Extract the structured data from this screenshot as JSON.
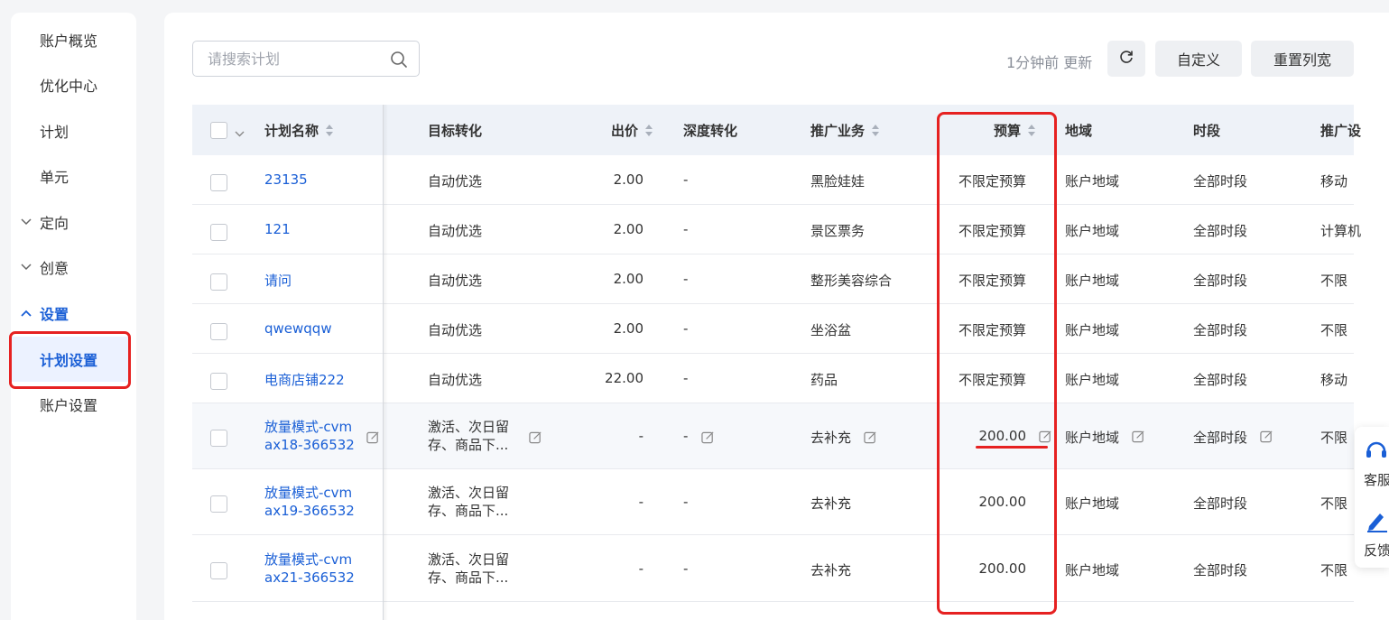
{
  "sidebar": {
    "items": [
      {
        "label": "账户概览"
      },
      {
        "label": "优化中心"
      },
      {
        "label": "计划"
      },
      {
        "label": "单元"
      },
      {
        "label": "定向"
      },
      {
        "label": "创意"
      },
      {
        "label": "设置"
      },
      {
        "label": "计划设置"
      },
      {
        "label": "账户设置"
      }
    ]
  },
  "toolbar": {
    "search_placeholder": "请搜索计划",
    "update_text": "1分钟前 更新",
    "custom_label": "自定义",
    "reset_label": "重置列宽"
  },
  "table": {
    "headers": {
      "name": "计划名称",
      "target": "目标转化",
      "bid": "出价",
      "deep": "深度转化",
      "business": "推广业务",
      "budget": "预算",
      "region": "地域",
      "period": "时段",
      "device": "推广设"
    },
    "rows": [
      {
        "name": "23135",
        "target": "自动优选",
        "bid": "2.00",
        "deep": "-",
        "business": "黑脸娃娃",
        "budget": "不限定预算",
        "region": "账户地域",
        "period": "全部时段",
        "device": "移动"
      },
      {
        "name": "121",
        "target": "自动优选",
        "bid": "2.00",
        "deep": "-",
        "business": "景区票务",
        "budget": "不限定预算",
        "region": "账户地域",
        "period": "全部时段",
        "device": "计算机"
      },
      {
        "name": "请问",
        "target": "自动优选",
        "bid": "2.00",
        "deep": "-",
        "business": "整形美容综合",
        "budget": "不限定预算",
        "region": "账户地域",
        "period": "全部时段",
        "device": "不限"
      },
      {
        "name": "qwewqqw",
        "target": "自动优选",
        "bid": "2.00",
        "deep": "-",
        "business": "坐浴盆",
        "budget": "不限定预算",
        "region": "账户地域",
        "period": "全部时段",
        "device": "不限"
      },
      {
        "name": "电商店铺222",
        "target": "自动优选",
        "bid": "22.00",
        "deep": "-",
        "business": "药品",
        "budget": "不限定预算",
        "region": "账户地域",
        "period": "全部时段",
        "device": "移动"
      },
      {
        "name_line1": "放量模式-cvm",
        "name_line2": "ax18-366532",
        "target_line1": "激活、次日留",
        "target_line2": "存、商品下...",
        "bid": "-",
        "deep": "-",
        "business": "去补充",
        "budget": "200.00",
        "region": "账户地域",
        "period": "全部时段",
        "device": "不限"
      },
      {
        "name_line1": "放量模式-cvm",
        "name_line2": "ax19-366532",
        "target_line1": "激活、次日留",
        "target_line2": "存、商品下...",
        "bid": "-",
        "deep": "-",
        "business": "去补充",
        "budget": "200.00",
        "region": "账户地域",
        "period": "全部时段",
        "device": "不限"
      },
      {
        "name_line1": "放量模式-cvm",
        "name_line2": "ax21-366532",
        "target_line1": "激活、次日留",
        "target_line2": "存、商品下...",
        "bid": "-",
        "deep": "-",
        "business": "去补充",
        "budget": "200.00",
        "region": "账户地域",
        "period": "全部时段",
        "device": "不限"
      }
    ]
  },
  "float": {
    "service_label": "客服",
    "feedback_label": "反馈"
  },
  "colors": {
    "accent": "#1a5fd6",
    "highlight": "#e62121"
  }
}
